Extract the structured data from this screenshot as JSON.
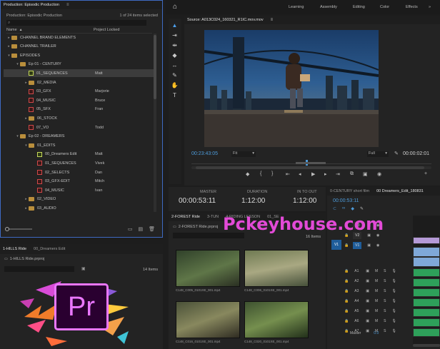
{
  "project": {
    "title": "Production: Episodic Production",
    "breadcrumb": "Production: Episodic Production",
    "selected_count": "1 of 24 items selected",
    "col_name": "Name",
    "col_locked": "Project Locked",
    "rows": [
      {
        "label": "CHANNEL BRAND ELEMENTS",
        "owner": ""
      },
      {
        "label": "CHANNEL TRAILER",
        "owner": ""
      },
      {
        "label": "EPISODES",
        "owner": ""
      },
      {
        "label": "Ep 01 - CENTURY",
        "owner": ""
      },
      {
        "label": "01_SEQUENCES",
        "owner": "Matt"
      },
      {
        "label": "02_MEDIA",
        "owner": ""
      },
      {
        "label": "03_GFX",
        "owner": "Marjorie"
      },
      {
        "label": "04_MUSIC",
        "owner": "Bruce"
      },
      {
        "label": "05_SFX",
        "owner": "Fran"
      },
      {
        "label": "06_STOCK",
        "owner": ""
      },
      {
        "label": "07_VO",
        "owner": "Todd"
      },
      {
        "label": "Ep 02 - DREAMERS",
        "owner": ""
      },
      {
        "label": "01_EDITS",
        "owner": ""
      },
      {
        "label": "00_Dreamers Edit",
        "owner": "Matt"
      },
      {
        "label": "01_SEQUENCES",
        "owner": "Vivek"
      },
      {
        "label": "02_SELECTS",
        "owner": "Dan"
      },
      {
        "label": "03_GFX-EDIT",
        "owner": "Mitch"
      },
      {
        "label": "04_MUSIC",
        "owner": "Ivan"
      },
      {
        "label": "02_VIDEO",
        "owner": ""
      },
      {
        "label": "03_AUDIO",
        "owner": ""
      }
    ]
  },
  "workspaces": [
    "Learning",
    "Assembly",
    "Editing",
    "Color",
    "Effects"
  ],
  "source": {
    "tab": "Source: A013C024_160321_R1IC.mov.mov",
    "timecode_in": "00:23:43:05",
    "fit": "Fit",
    "quality": "Full",
    "timecode_out": "00:00:02:01"
  },
  "stats": {
    "master_label": "MASTER",
    "master_value": "00:00:53:11",
    "duration_label": "DURATION",
    "duration_value": "1:12:00",
    "inout_label": "IN TO OUT",
    "inout_value": "1:12:00"
  },
  "timeline": {
    "tabs": [
      "0-CENTURY short film",
      "00 Dreamers_Edit_180831"
    ],
    "timecode": "00:00:53:11",
    "video_tracks": [
      "V3",
      "V2",
      "V1"
    ],
    "source_tag": "V1",
    "audio_tracks": [
      "A1",
      "A2",
      "A3",
      "A4",
      "A5",
      "A6",
      "A7"
    ],
    "master": "Master",
    "master_value": "0.0",
    "mute": "M",
    "solo": "S"
  },
  "bin2": {
    "tabs": [
      "2-FOREST Ride",
      "3-TUN",
      "4-RIDING LESSON",
      "01_SE"
    ],
    "path": "2-FOREST Ride.prproj",
    "count": "16 Items",
    "thumbs": [
      "C148_C005_0101XE_001.mp4",
      "C148_C006_0101XE_001.mp4",
      "C148_C016_0101XE_001.mp4",
      "C148_C020_0101XE_001.mp4"
    ]
  },
  "bin1": {
    "tabs": [
      "1-HILLS Ride",
      "00_Dreamers Edit"
    ],
    "path": "1-HILLS Ride.prproj",
    "count": "14 Items"
  },
  "logo": {
    "text": "Pr"
  },
  "watermark": "Pckeyhouse.com",
  "colors": {
    "accent": "#2d8ceb",
    "timecode": "#4d9ad8",
    "pr_purple": "#ea77ff",
    "watermark": "#e24ad7"
  }
}
